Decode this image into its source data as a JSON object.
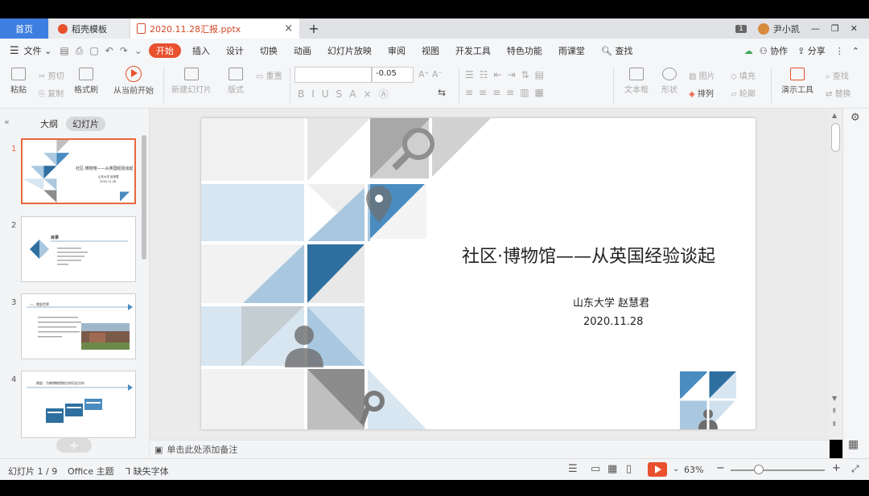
{
  "tabs": {
    "home": "首页",
    "template": "稻壳模板",
    "document": "2020.11.28汇报.pptx",
    "close": "×",
    "add": "+"
  },
  "window": {
    "badge": "1",
    "user": "尹小凯"
  },
  "menu": {
    "file": "文件",
    "items": [
      "开始",
      "插入",
      "设计",
      "切换",
      "动画",
      "幻灯片放映",
      "审阅",
      "视图",
      "开发工具",
      "特色功能",
      "雨课堂"
    ],
    "search": "查找",
    "collab": "协作",
    "share": "分享"
  },
  "ribbon": {
    "paste": "粘贴",
    "cut": "剪切",
    "copy": "复制",
    "format_painter": "格式刷",
    "from_current": "从当前开始",
    "new_slide": "新建幻灯片",
    "layout": "版式",
    "reset": "重置",
    "font_size": "-0.05",
    "text_box": "文本框",
    "shape": "形状",
    "picture": "图片",
    "fill": "填充",
    "arrange": "排列",
    "outline": "轮廓",
    "present_tool": "演示工具",
    "find": "查找",
    "replace": "替换"
  },
  "left_pane": {
    "outline_tab": "大纲",
    "slides_tab": "幻灯片",
    "slide_numbers": [
      "1",
      "2",
      "3",
      "4"
    ],
    "thumb1_title": "社区·博物馆——从英国经验谈起",
    "thumb1_author": "山东大学 赵慧君",
    "thumb1_date": "2020.11.28",
    "thumb2_heading": "目录",
    "thumb3_heading": "一、缘起世界",
    "thumb4_heading": "缘起：为做博物馆地位的历史分析"
  },
  "slide": {
    "title": "社区·博物馆——从英国经验谈起",
    "author": "山东大学  赵慧君",
    "date": "2020.11.28"
  },
  "notes": {
    "placeholder": "单击此处添加备注"
  },
  "status": {
    "slide_info": "幻灯片 1 / 9",
    "theme": "Office 主题",
    "missing_font": "缺失字体",
    "zoom": "63%"
  },
  "colors": {
    "accent": "#e8502e",
    "home_tab": "#3d7fe0",
    "slide_dark_blue": "#2f6f9f",
    "slide_mid_blue": "#4a8cc0",
    "slide_light_blue": "#a9c8e0",
    "slide_pale_blue": "#d8e6f1",
    "slide_gray": "#8c8c8c"
  }
}
